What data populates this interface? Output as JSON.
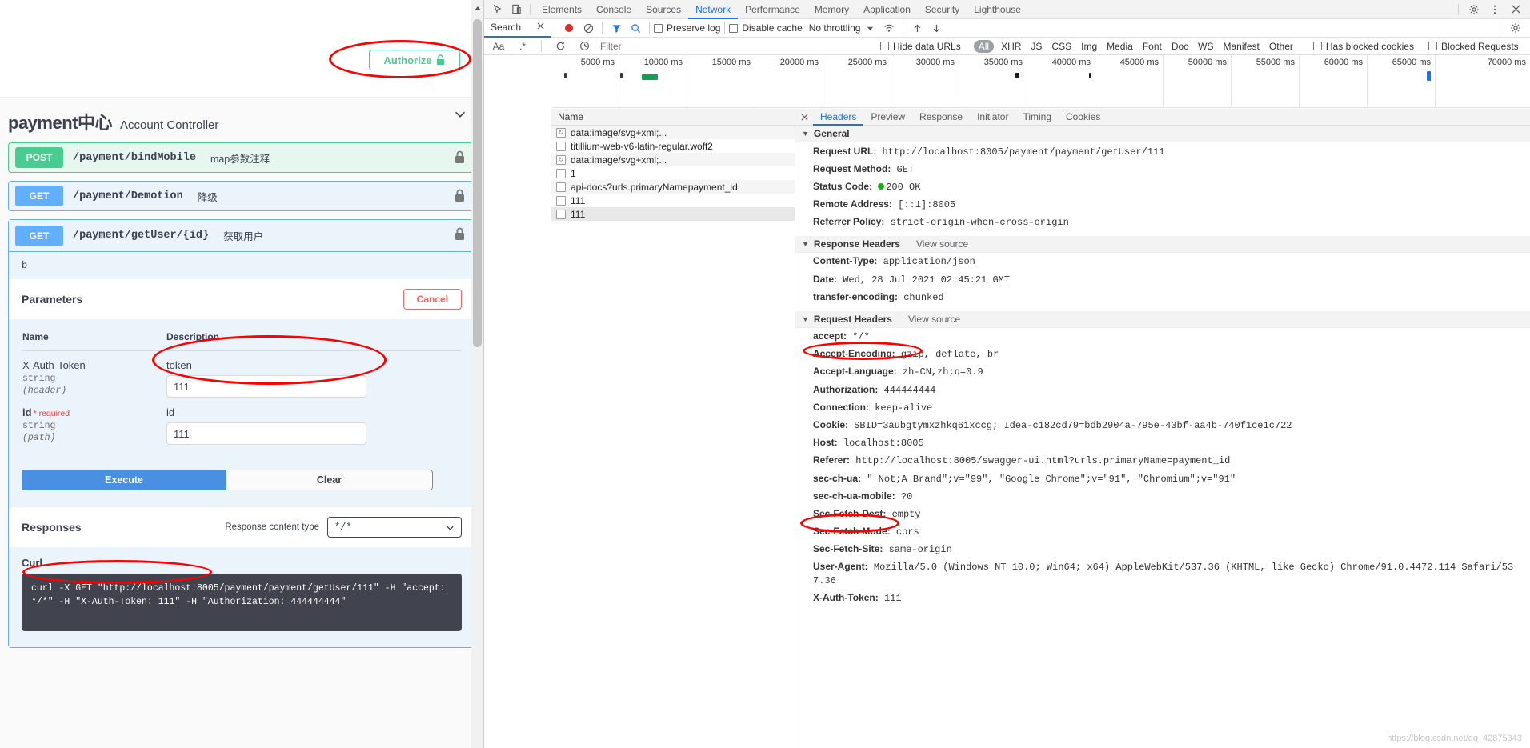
{
  "swagger": {
    "authorize_label": "Authorize",
    "logo": "payment中心",
    "controller": "Account Controller",
    "operations": [
      {
        "method": "POST",
        "path": "/payment/bindMobile",
        "desc": "map参数注释",
        "style": "post"
      },
      {
        "method": "GET",
        "path": "/payment/Demotion",
        "desc": "降级",
        "style": "get"
      }
    ],
    "open_operation": {
      "method": "GET",
      "path": "/payment/getUser/{id}",
      "desc": "获取用户",
      "description_body": "b",
      "parameters_title": "Parameters",
      "cancel_label": "Cancel",
      "col_name": "Name",
      "col_description": "Description",
      "rows": [
        {
          "name": "X-Auth-Token",
          "required": "",
          "type": "string",
          "in": "(header)",
          "desc": "token",
          "value": "111",
          "placeholder": "X-Auth-Token"
        },
        {
          "name": "id",
          "required": "* required",
          "type": "string",
          "in": "(path)",
          "desc": "id",
          "value": "111",
          "placeholder": "id"
        }
      ],
      "execute_label": "Execute",
      "clear_label": "Clear",
      "responses_title": "Responses",
      "response_content_type_label": "Response content type",
      "response_content_type_value": "*/*",
      "curl_label": "Curl",
      "curl_command": "curl -X GET \"http://localhost:8005/payment/payment/getUser/111\" -H \"accept: */*\" -H \"X-Auth-Token: 111\" -H \"Authorization: 444444444\""
    }
  },
  "devtools": {
    "panel_tabs": [
      "Elements",
      "Console",
      "Sources",
      "Network",
      "Performance",
      "Memory",
      "Application",
      "Security",
      "Lighthouse"
    ],
    "active_panel_tab": "Network",
    "search_tab_label": "Search",
    "preserve_log_label": "Preserve log",
    "disable_cache_label": "Disable cache",
    "throttling_value": "No throttling",
    "filter_placeholder": "Filter",
    "hide_data_urls_label": "Hide data URLs",
    "resource_types": [
      "All",
      "XHR",
      "JS",
      "CSS",
      "Img",
      "Media",
      "Font",
      "Doc",
      "WS",
      "Manifest",
      "Other"
    ],
    "active_resource_type": "All",
    "has_blocked_cookies_label": "Has blocked cookies",
    "blocked_requests_label": "Blocked Requests",
    "timeline_ticks": [
      "5000 ms",
      "10000 ms",
      "15000 ms",
      "20000 ms",
      "25000 ms",
      "30000 ms",
      "35000 ms",
      "40000 ms",
      "45000 ms",
      "50000 ms",
      "55000 ms",
      "60000 ms",
      "65000 ms",
      "70000 ms"
    ],
    "requests_column_header": "Name",
    "requests": [
      {
        "name": "data:image/svg+xml;...",
        "icon": "refresh-icon",
        "selected": false
      },
      {
        "name": "titillium-web-v6-latin-regular.woff2",
        "icon": "doc-icon",
        "selected": false
      },
      {
        "name": "data:image/svg+xml;...",
        "icon": "refresh-icon",
        "selected": false
      },
      {
        "name": "1",
        "icon": "doc-icon",
        "selected": false
      },
      {
        "name": "api-docs?urls.primaryNamepayment_id",
        "icon": "doc-icon",
        "selected": false
      },
      {
        "name": "111",
        "icon": "doc-icon",
        "selected": false
      },
      {
        "name": "111",
        "icon": "doc-icon",
        "selected": true
      }
    ],
    "detail_tabs": [
      "Headers",
      "Preview",
      "Response",
      "Initiator",
      "Timing",
      "Cookies"
    ],
    "active_detail_tab": "Headers",
    "general_title": "General",
    "general": [
      {
        "key": "Request URL:",
        "value": "http://localhost:8005/payment/payment/getUser/111"
      },
      {
        "key": "Request Method:",
        "value": "GET"
      },
      {
        "key": "Status Code:",
        "value": "200 OK",
        "status_dot": true
      },
      {
        "key": "Remote Address:",
        "value": "[::1]:8005"
      },
      {
        "key": "Referrer Policy:",
        "value": "strict-origin-when-cross-origin"
      }
    ],
    "response_headers_title": "Response Headers",
    "view_source_label": "View source",
    "response_headers": [
      {
        "key": "Content-Type:",
        "value": "application/json"
      },
      {
        "key": "Date:",
        "value": "Wed, 28 Jul 2021 02:45:21 GMT"
      },
      {
        "key": "transfer-encoding:",
        "value": "chunked"
      }
    ],
    "request_headers_title": "Request Headers",
    "request_headers": [
      {
        "key": "accept:",
        "value": "*/*"
      },
      {
        "key": "Accept-Encoding:",
        "value": "gzip, deflate, br"
      },
      {
        "key": "Accept-Language:",
        "value": "zh-CN,zh;q=0.9"
      },
      {
        "key": "Authorization:",
        "value": "444444444"
      },
      {
        "key": "Connection:",
        "value": "keep-alive"
      },
      {
        "key": "Cookie:",
        "value": "SBID=3aubgtymxzhkq61xccg; Idea-c182cd79=bdb2904a-795e-43bf-aa4b-740f1ce1c722"
      },
      {
        "key": "Host:",
        "value": "localhost:8005"
      },
      {
        "key": "Referer:",
        "value": "http://localhost:8005/swagger-ui.html?urls.primaryName=payment_id"
      },
      {
        "key": "sec-ch-ua:",
        "value": "\" Not;A Brand\";v=\"99\", \"Google Chrome\";v=\"91\", \"Chromium\";v=\"91\""
      },
      {
        "key": "sec-ch-ua-mobile:",
        "value": "?0"
      },
      {
        "key": "Sec-Fetch-Dest:",
        "value": "empty"
      },
      {
        "key": "Sec-Fetch-Mode:",
        "value": "cors"
      },
      {
        "key": "Sec-Fetch-Site:",
        "value": "same-origin"
      },
      {
        "key": "User-Agent:",
        "value": "Mozilla/5.0 (Windows NT 10.0; Win64; x64) AppleWebKit/537.36 (KHTML, like Gecko) Chrome/91.0.4472.114 Safari/537.36"
      },
      {
        "key": "X-Auth-Token:",
        "value": "111"
      }
    ]
  },
  "watermark": "https://blog.csdn.net/qq_42875343",
  "colors": {
    "accent_blue": "#1a73e8",
    "get_blue": "#61affe",
    "post_green": "#49cc90",
    "annotation_red": "#ff0000"
  }
}
